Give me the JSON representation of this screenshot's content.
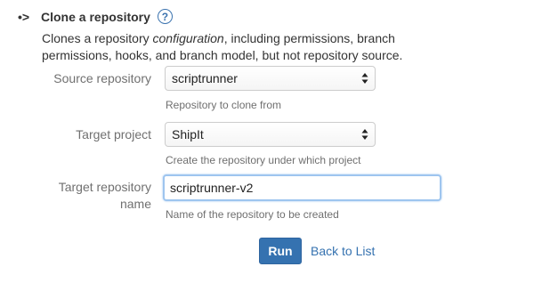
{
  "section": {
    "bullet": "•>",
    "title": "Clone a repository",
    "help_glyph": "?",
    "description_before": "Clones a repository ",
    "description_em": "configuration",
    "description_after": ", including permissions, branch permissions, hooks, and branch model, but not repository source."
  },
  "form": {
    "source_repository": {
      "label": "Source repository",
      "value": "scriptrunner",
      "hint": "Repository to clone from"
    },
    "target_project": {
      "label": "Target project",
      "value": "ShipIt",
      "hint": "Create the repository under which project"
    },
    "target_repository_name": {
      "label_line1": "Target repository",
      "label_line2": "name",
      "value": "scriptrunner-v2",
      "hint": "Name of the repository to be created"
    }
  },
  "actions": {
    "run_label": "Run",
    "back_label": "Back to List"
  },
  "colors": {
    "accent": "#3572b0",
    "focus_border": "#9ec5ef"
  }
}
